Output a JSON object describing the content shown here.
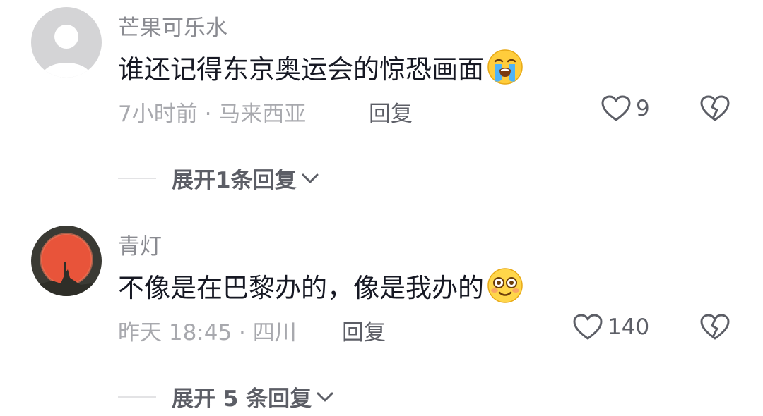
{
  "comments": [
    {
      "username": "芒果可乐水",
      "avatar_icon": "default-avatar-icon",
      "text": "谁还记得东京奥运会的惊恐画面",
      "emoji": "loudly-crying-emoji-icon",
      "time_location": "7小时前 · 马来西亚",
      "reply_label": "回复",
      "like_count": "9",
      "expand_label": "展开1条回复"
    },
    {
      "username": "青灯",
      "avatar_icon": "sunset-avatar-icon",
      "text": "不像是在巴黎办的，像是我办的",
      "emoji": "flushed-smile-emoji-icon",
      "time_location": "昨天 18:45 · 四川",
      "reply_label": "回复",
      "like_count": "140",
      "expand_label": "展开 5 条回复"
    }
  ],
  "colors": {
    "username": "#8a8b91",
    "text": "#161823",
    "meta": "#a8a9ae",
    "action": "#5c5e66",
    "avatar_sun": "#e8543a"
  }
}
